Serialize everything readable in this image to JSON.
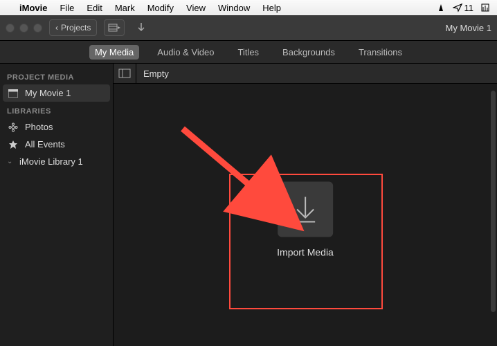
{
  "menubar": {
    "app": "iMovie",
    "items": [
      "File",
      "Edit",
      "Mark",
      "Modify",
      "View",
      "Window",
      "Help"
    ],
    "extras": {
      "cone": "▾",
      "paper_count": "11"
    }
  },
  "toolbar": {
    "projects_label": "Projects",
    "title": "My Movie 1"
  },
  "tabs": [
    "My Media",
    "Audio & Video",
    "Titles",
    "Backgrounds",
    "Transitions"
  ],
  "active_tab": 0,
  "sidebar": {
    "section1": "PROJECT MEDIA",
    "project": "My Movie 1",
    "section2": "LIBRARIES",
    "lib_items": [
      "Photos",
      "All Events"
    ],
    "library": "iMovie Library 1"
  },
  "mainhdr": {
    "status": "Empty"
  },
  "import": {
    "label": "Import Media"
  }
}
